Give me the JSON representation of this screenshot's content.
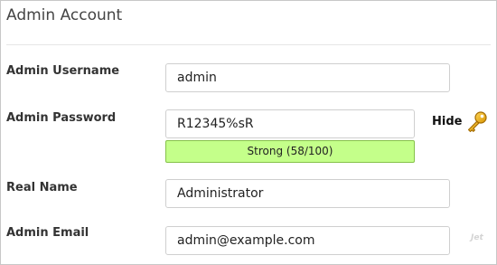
{
  "section": {
    "title": "Admin Account"
  },
  "fields": {
    "username": {
      "label": "Admin Username",
      "value": "admin"
    },
    "password": {
      "label": "Admin Password",
      "value": "R12345%sR",
      "strength_text": "Strong (58/100)",
      "strength_score": 58,
      "strength_color": "#c4ff8a",
      "toggle_label": "Hide"
    },
    "real_name": {
      "label": "Real Name",
      "value": "Administrator"
    },
    "email": {
      "label": "Admin Email",
      "value": "admin@example.com"
    }
  },
  "icons": {
    "toggle_icon": "key-icon"
  },
  "watermark": "Jet"
}
